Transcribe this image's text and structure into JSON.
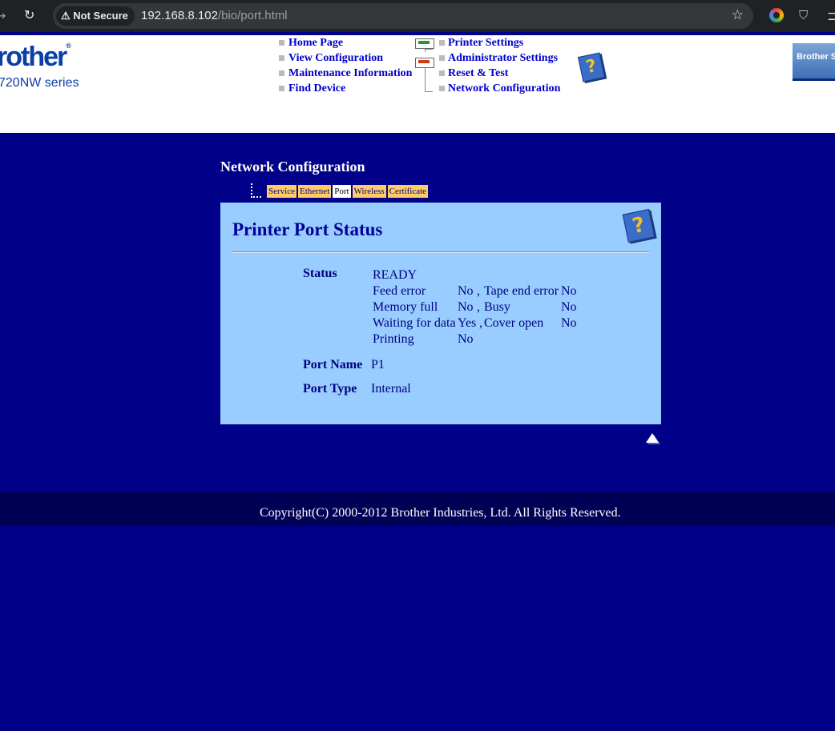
{
  "browser": {
    "security_label": "Not Secure",
    "url_host": "192.168.8.102",
    "url_path": "/bio/port.html"
  },
  "header": {
    "logo_text": "rother",
    "logo_registered": "®",
    "model_text": "720NW series",
    "menu_left": [
      {
        "label": "Home Page"
      },
      {
        "label": "View Configuration"
      },
      {
        "label": "Maintenance Information"
      },
      {
        "label": "Find Device"
      }
    ],
    "menu_right": [
      {
        "label": "Printer Settings"
      },
      {
        "label": "Administrator Settings"
      },
      {
        "label": "Reset & Test"
      },
      {
        "label": "Network Configuration"
      }
    ],
    "help_icon": "?",
    "banner_text": "Brother S"
  },
  "main": {
    "section_title": "Network Configuration",
    "tabs": [
      {
        "label": "Service"
      },
      {
        "label": "Ethernet"
      },
      {
        "label": "Port"
      },
      {
        "label": "Wireless"
      },
      {
        "label": "Certificate"
      }
    ],
    "active_tab": "Port",
    "panel": {
      "title": "Printer Port Status",
      "status_label": "Status",
      "status_value": "READY",
      "status_details": [
        {
          "name": "Feed error",
          "value": "No",
          "sep": ",",
          "name2": "Tape end error",
          "value2": "No"
        },
        {
          "name": "Memory full",
          "value": "No",
          "sep": ",",
          "name2": "Busy",
          "value2": "No"
        },
        {
          "name": "Waiting for data",
          "value": "Yes",
          "sep": ",",
          "name2": "Cover open",
          "value2": "No"
        },
        {
          "name": "Printing",
          "value": "No"
        }
      ],
      "port_name_label": "Port Name",
      "port_name_value": "P1",
      "port_type_label": "Port Type",
      "port_type_value": "Internal"
    }
  },
  "footer": {
    "copyright": "Copyright(C) 2000-2012 Brother Industries, Ltd. All Rights Reserved."
  },
  "colors": {
    "page_bg": "#000088",
    "panel_bg": "#99ccff",
    "tab_bg": "#ffcc66",
    "link": "#0000cc"
  }
}
